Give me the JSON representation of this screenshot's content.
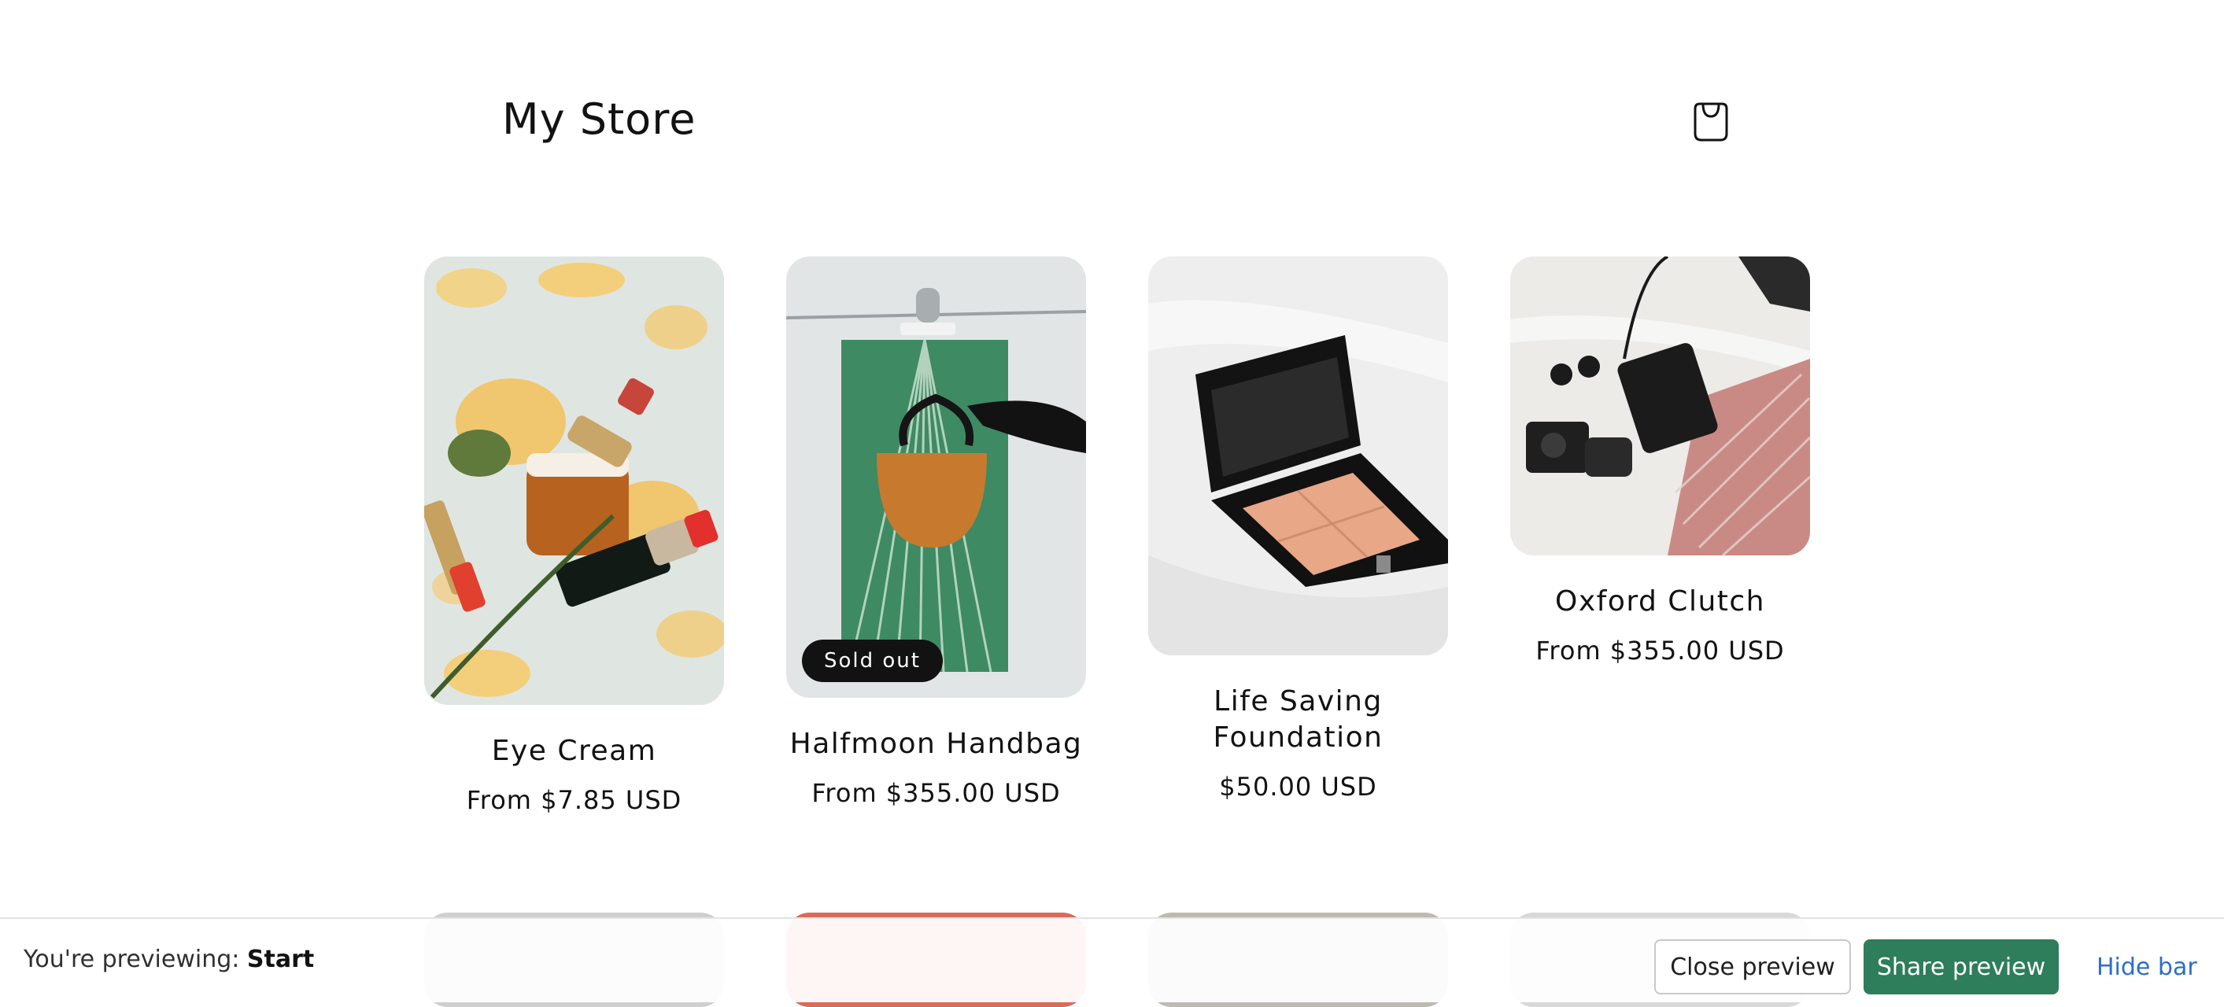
{
  "header": {
    "store_name": "My Store",
    "cart_icon": "shopping-bag-icon"
  },
  "products": [
    {
      "title": "Eye Cream",
      "price": "From $7.85 USD",
      "badge": ""
    },
    {
      "title": "Halfmoon Handbag",
      "price": "From $355.00 USD",
      "badge": "Sold out"
    },
    {
      "title": "Life Saving Foundation",
      "price": "$50.00 USD",
      "badge": ""
    },
    {
      "title": "Oxford Clutch",
      "price": "From $355.00 USD",
      "badge": ""
    }
  ],
  "preview_bar": {
    "label": "You're previewing: ",
    "theme_name": "Start",
    "close_label": "Close preview",
    "share_label": "Share preview",
    "hide_label": "Hide bar"
  },
  "colors": {
    "share_button": "#2e7d5b",
    "hide_link": "#2c6ecb",
    "badge": "#121212"
  }
}
